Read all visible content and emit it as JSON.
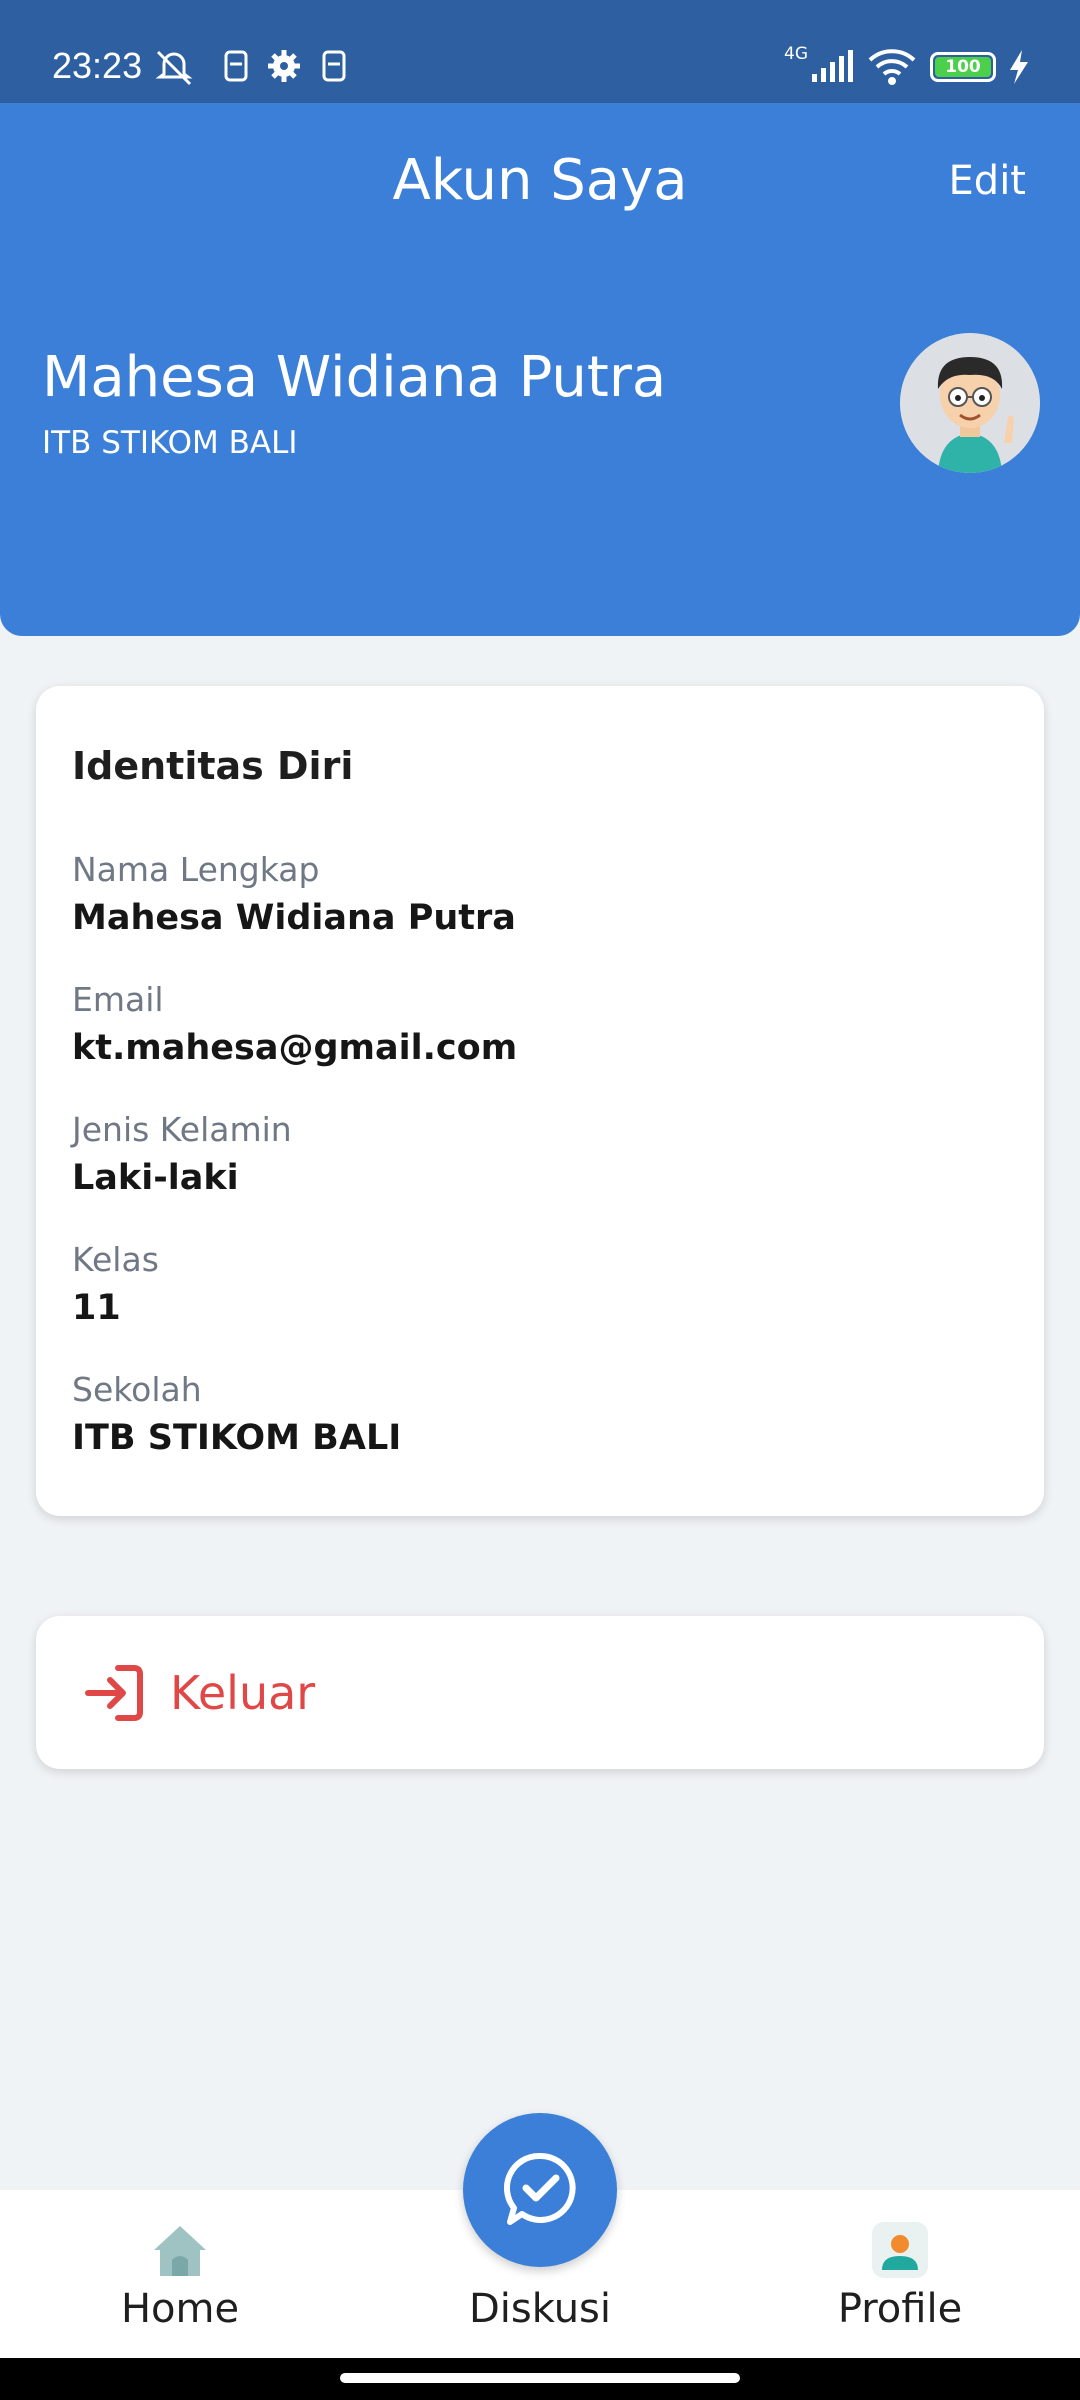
{
  "status_bar": {
    "time": "23:23",
    "network": "4G",
    "battery": "100",
    "icons": [
      "mute-bell-icon",
      "sim-icon",
      "gear-icon",
      "sim-icon",
      "signal-icon",
      "wifi-icon",
      "battery-icon",
      "charging-icon"
    ]
  },
  "header": {
    "title": "Akun Saya",
    "edit_label": "Edit",
    "name": "Mahesa Widiana Putra",
    "school": "ITB STIKOM BALI",
    "color": "#3b7fd8"
  },
  "identity": {
    "title": "Identitas Diri",
    "fields": [
      {
        "label": "Nama Lengkap",
        "value": "Mahesa Widiana Putra"
      },
      {
        "label": "Email",
        "value": "kt.mahesa@gmail.com"
      },
      {
        "label": "Jenis Kelamin",
        "value": "Laki-laki"
      },
      {
        "label": "Kelas",
        "value": "11"
      },
      {
        "label": "Sekolah",
        "value": "ITB STIKOM BALI"
      }
    ]
  },
  "logout": {
    "label": "Keluar",
    "icon": "logout-icon",
    "color": "#e04848"
  },
  "bottom_nav": {
    "items": [
      {
        "label": "Home",
        "icon": "home-icon"
      },
      {
        "label": "Diskusi",
        "icon": "chat-check-icon"
      },
      {
        "label": "Profile",
        "icon": "profile-icon"
      }
    ]
  }
}
